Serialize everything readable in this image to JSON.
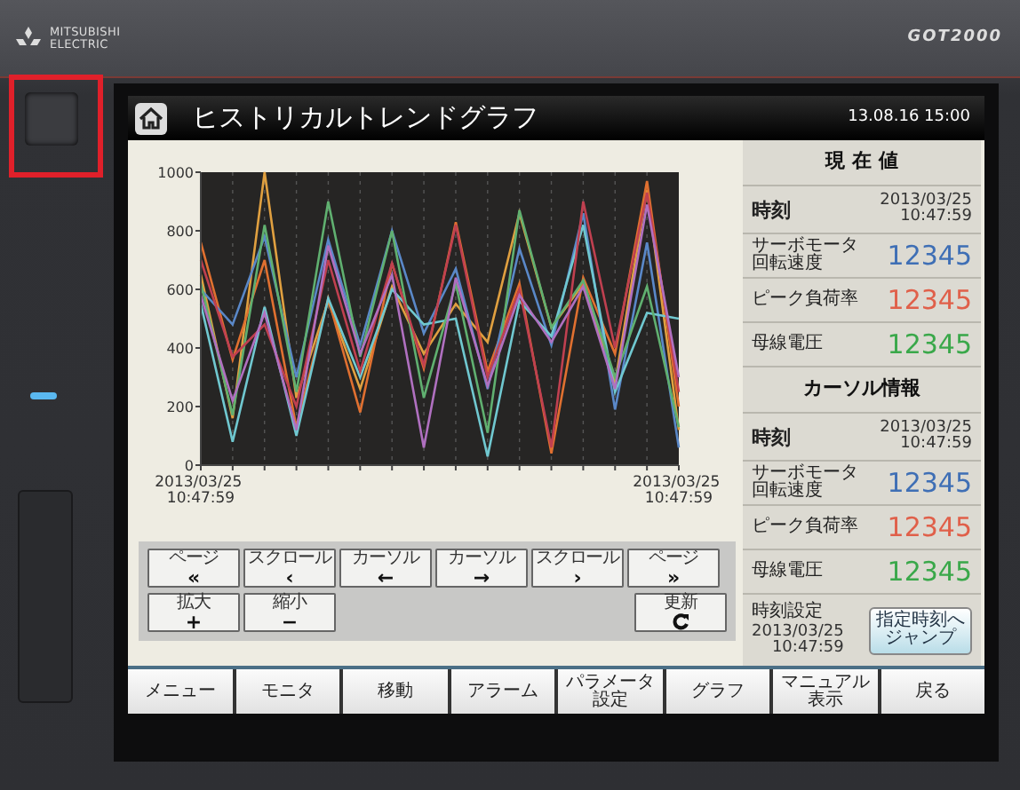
{
  "device": {
    "brand": "MITSUBISHI\nELECTRIC",
    "model": "GOT2000"
  },
  "title_bar": {
    "title": "ヒストリカルトレンドグラフ",
    "datetime": "13.08.16  15:00"
  },
  "chart_data": {
    "type": "line",
    "categories": [
      "2013/03/25 10:47:59",
      null,
      null,
      null,
      null,
      null,
      null,
      null,
      null,
      null,
      null,
      null,
      null,
      null,
      null,
      "2013/03/25 10:47:59"
    ],
    "ylim": [
      0,
      1000
    ],
    "grid": true,
    "yticks": [
      0,
      200,
      400,
      600,
      800,
      1000
    ],
    "series": [
      {
        "color": "#e0a040",
        "values": [
          650,
          160,
          1000,
          230,
          560,
          260,
          610,
          380,
          550,
          420,
          860,
          470,
          620,
          280,
          940,
          120
        ]
      },
      {
        "color": "#e07030",
        "values": [
          760,
          360,
          700,
          130,
          570,
          180,
          690,
          330,
          830,
          320,
          620,
          40,
          640,
          380,
          970,
          200
        ]
      },
      {
        "color": "#5a88c8",
        "values": [
          600,
          480,
          780,
          300,
          770,
          410,
          800,
          450,
          670,
          260,
          740,
          410,
          860,
          190,
          760,
          60
        ]
      },
      {
        "color": "#70c8d0",
        "values": [
          550,
          80,
          540,
          100,
          570,
          300,
          600,
          480,
          500,
          30,
          560,
          440,
          820,
          250,
          520,
          500
        ]
      },
      {
        "color": "#60b070",
        "values": [
          620,
          170,
          820,
          250,
          900,
          370,
          800,
          230,
          620,
          110,
          870,
          470,
          630,
          300,
          610,
          130
        ]
      },
      {
        "color": "#c04050",
        "values": [
          700,
          370,
          480,
          200,
          700,
          320,
          690,
          340,
          820,
          300,
          600,
          60,
          900,
          400,
          930,
          250
        ]
      },
      {
        "color": "#b070c0",
        "values": [
          580,
          220,
          520,
          120,
          750,
          380,
          650,
          60,
          640,
          270,
          580,
          420,
          610,
          260,
          890,
          300
        ]
      }
    ]
  },
  "control_buttons": [
    [
      {
        "kind": "text",
        "label": "ページ",
        "symbol": "«"
      },
      {
        "kind": "text",
        "label": "スクロール",
        "symbol": "‹"
      },
      {
        "kind": "text",
        "label": "カーソル",
        "symbol": "←"
      },
      {
        "kind": "text",
        "label": "カーソル",
        "symbol": "→"
      },
      {
        "kind": "text",
        "label": "スクロール",
        "symbol": "›"
      },
      {
        "kind": "text",
        "label": "ページ",
        "symbol": "»"
      }
    ],
    [
      {
        "kind": "text",
        "label": "拡大",
        "symbol": "+"
      },
      {
        "kind": "text",
        "label": "縮小",
        "symbol": "−"
      },
      {
        "kind": "refresh",
        "label": "更新"
      }
    ]
  ],
  "panel": [
    {
      "kind": "header",
      "label": "現 在 値"
    },
    {
      "kind": "time",
      "label": "時刻",
      "value": "2013/03/25\n10:47:59"
    },
    {
      "kind": "value",
      "label": "サーボモータ回転速度",
      "value": "12345",
      "color": "#3f6fb5"
    },
    {
      "kind": "value",
      "label": "ピーク負荷率",
      "value": "12345",
      "color": "#e0604a"
    },
    {
      "kind": "value",
      "label": "母線電圧",
      "value": "12345",
      "color": "#3aa84a"
    },
    {
      "kind": "header",
      "label": "カーソル情報"
    },
    {
      "kind": "time",
      "label": "時刻",
      "value": "2013/03/25\n10:47:59"
    },
    {
      "kind": "value",
      "label": "サーボモータ回転速度",
      "value": "12345",
      "color": "#3f6fb5"
    },
    {
      "kind": "value",
      "label": "ピーク負荷率",
      "value": "12345",
      "color": "#e0604a"
    },
    {
      "kind": "value",
      "label": "母線電圧",
      "value": "12345",
      "color": "#3aa84a"
    },
    {
      "kind": "setting",
      "label": "時刻設定",
      "value": "2013/03/25\n10:47:59",
      "button": "指定時刻へジャンプ"
    }
  ],
  "nav": [
    "メニュー",
    "モニタ",
    "移動",
    "アラーム",
    "パラメータ設定",
    "グラフ",
    "マニュアル表示",
    "戻る"
  ]
}
